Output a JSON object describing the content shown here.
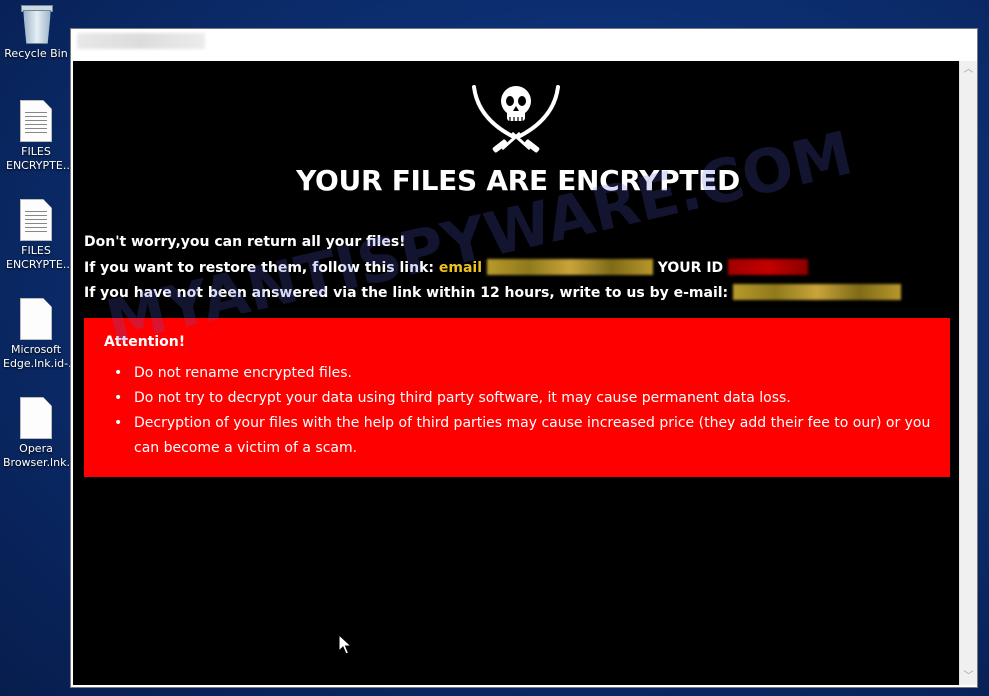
{
  "desktop": {
    "icons": [
      {
        "label": "Recycle Bin",
        "icon": "recycle-bin-icon"
      },
      {
        "label": "FILES ENCRYPTE...",
        "icon": "text-document-icon"
      },
      {
        "label": "FILES ENCRYPTE...",
        "icon": "text-document-icon"
      },
      {
        "label": "Microsoft Edge.lnk.id-...",
        "icon": "file-icon"
      },
      {
        "label": "Opera Browser.lnk....",
        "icon": "file-icon"
      }
    ]
  },
  "window": {
    "scroll_up": "︿",
    "scroll_down": "﹀"
  },
  "note": {
    "logo_icon": "pirate-skull-crossed-swords-icon",
    "headline": "YOUR FILES ARE ENCRYPTED",
    "line1": "Don't worry,you can return all your files!",
    "line2_prefix": "If you want to restore them, follow this link:",
    "line2_email_label": "email",
    "line2_id_label": "YOUR ID",
    "line3_prefix": "If you have not been answered via the link within 12 hours, write to us by e-mail:",
    "attention_title": "Attention!",
    "attention_items": [
      "Do not rename encrypted files.",
      "Do not try to decrypt your data using third party software, it may cause permanent data loss.",
      "Decryption of your files with the help of third parties may cause increased price (they add their fee to our) or you can become a victim of a scam."
    ]
  },
  "watermark": "MYANTISPYWARE.COM",
  "colors": {
    "note_background": "#000000",
    "attention_background": "#fe0000",
    "highlight": "#f0c020"
  }
}
